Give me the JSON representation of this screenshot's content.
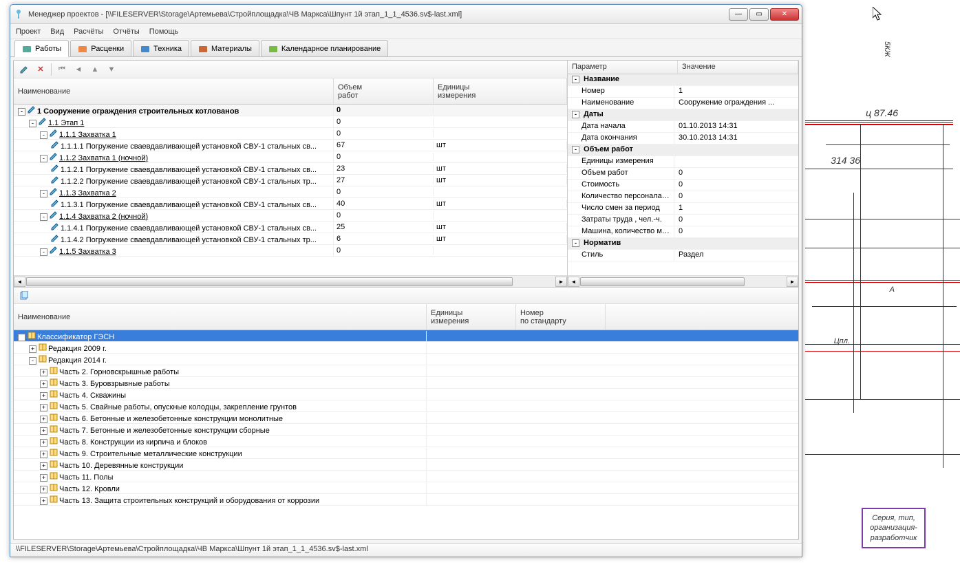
{
  "window_title": "Менеджер проектов - [\\\\FILESERVER\\Storage\\Артемьева\\Стройплощадка\\ЧВ Маркса\\Шпунт 1й этап_1_1_4536.sv$-last.xml]",
  "statusbar": "\\\\FILESERVER\\Storage\\Артемьева\\Стройплощадка\\ЧВ Маркса\\Шпунт 1й этап_1_1_4536.sv$-last.xml",
  "menu": [
    "Проект",
    "Вид",
    "Расчёты",
    "Отчёты",
    "Помощь"
  ],
  "tabs": [
    {
      "label": "Работы",
      "active": true
    },
    {
      "label": "Расценки"
    },
    {
      "label": "Техника"
    },
    {
      "label": "Материалы"
    },
    {
      "label": "Календарное планирование"
    }
  ],
  "works_grid": {
    "headers": [
      "Наименование",
      "Объем\nработ",
      "Единицы\nизмерения"
    ],
    "rows": [
      {
        "indent": 0,
        "expand": "-",
        "bold": true,
        "name": "1 Сооружение ограждения строительных котлованов",
        "vol": "0",
        "unit": ""
      },
      {
        "indent": 1,
        "expand": "-",
        "link": true,
        "name": "1.1 Этап 1",
        "vol": "0",
        "unit": ""
      },
      {
        "indent": 2,
        "expand": "-",
        "link": true,
        "name": "1.1.1 Захватка 1",
        "vol": "0",
        "unit": ""
      },
      {
        "indent": 3,
        "name": "1.1.1.1 Погружение сваевдавливающей установкой СВУ-1 стальных св...",
        "vol": "67",
        "unit": "шт"
      },
      {
        "indent": 2,
        "expand": "-",
        "link": true,
        "name": "1.1.2 Захватка 1 (ночной)",
        "vol": "0",
        "unit": ""
      },
      {
        "indent": 3,
        "name": "1.1.2.1 Погружение сваевдавливающей установкой СВУ-1 стальных св...",
        "vol": "23",
        "unit": "шт"
      },
      {
        "indent": 3,
        "name": "1.1.2.2 Погружение сваевдавливающей установкой СВУ-1 стальных тр...",
        "vol": "27",
        "unit": "шт"
      },
      {
        "indent": 2,
        "expand": "-",
        "link": true,
        "name": "1.1.3 Захватка 2",
        "vol": "0",
        "unit": ""
      },
      {
        "indent": 3,
        "name": "1.1.3.1 Погружение сваевдавливающей установкой СВУ-1 стальных св...",
        "vol": "40",
        "unit": "шт"
      },
      {
        "indent": 2,
        "expand": "-",
        "link": true,
        "name": "1.1.4 Захватка 2 (ночной)",
        "vol": "0",
        "unit": ""
      },
      {
        "indent": 3,
        "name": "1.1.4.1 Погружение сваевдавливающей установкой СВУ-1 стальных св...",
        "vol": "25",
        "unit": "шт"
      },
      {
        "indent": 3,
        "name": "1.1.4.2 Погружение сваевдавливающей установкой СВУ-1 стальных тр...",
        "vol": "6",
        "unit": "шт"
      },
      {
        "indent": 2,
        "expand": "-",
        "link": true,
        "name": "1.1.5 Захватка 3",
        "vol": "0",
        "unit": ""
      }
    ]
  },
  "props": {
    "headers": [
      "Параметр",
      "Значение"
    ],
    "groups": [
      {
        "title": "Название",
        "rows": [
          [
            "Номер",
            "1"
          ],
          [
            "Наименование",
            "Сооружение ограждения ..."
          ]
        ]
      },
      {
        "title": "Даты",
        "rows": [
          [
            "Дата начала",
            "01.10.2013 14:31"
          ],
          [
            "Дата окончания",
            "30.10.2013 14:31"
          ]
        ]
      },
      {
        "title": "Объем работ",
        "rows": [
          [
            "Единицы измерения",
            ""
          ],
          [
            "Объем работ",
            "0"
          ],
          [
            "Стоимость",
            "0"
          ],
          [
            "Количество персонала в с...",
            "0"
          ],
          [
            "Число смен за период",
            "1"
          ],
          [
            "Затраты труда , чел.-ч.",
            "0"
          ],
          [
            "Машина, количество маш...",
            "0"
          ]
        ]
      },
      {
        "title": "Норматив",
        "rows": [
          [
            "Стиль",
            "Раздел"
          ]
        ]
      }
    ]
  },
  "classifier": {
    "headers": [
      "Наименование",
      "Единицы\nизмерения",
      "Номер\nпо стандарту"
    ],
    "rows": [
      {
        "indent": 0,
        "expand": "-",
        "selected": true,
        "name": "Классификатор ГЭСН"
      },
      {
        "indent": 1,
        "expand": "+",
        "name": "Редакция 2009 г."
      },
      {
        "indent": 1,
        "expand": "-",
        "name": "Редакция 2014 г."
      },
      {
        "indent": 2,
        "expand": "+",
        "name": "Часть 2. Горновскрышные работы"
      },
      {
        "indent": 2,
        "expand": "+",
        "name": "Часть 3. Буровзрывные работы"
      },
      {
        "indent": 2,
        "expand": "+",
        "name": "Часть 4. Скважины"
      },
      {
        "indent": 2,
        "expand": "+",
        "name": "Часть 5. Свайные работы, опускные колодцы, закрепление грунтов"
      },
      {
        "indent": 2,
        "expand": "+",
        "name": "Часть 6. Бетонные и железобетонные конструкции монолитные"
      },
      {
        "indent": 2,
        "expand": "+",
        "name": "Часть 7. Бетонные и железобетонные конструкции сборные"
      },
      {
        "indent": 2,
        "expand": "+",
        "name": "Часть 8. Конструкции из кирпича и блоков"
      },
      {
        "indent": 2,
        "expand": "+",
        "name": "Часть 9. Строительные металлические конструкции"
      },
      {
        "indent": 2,
        "expand": "+",
        "name": "Часть 10. Деревянные конструкции"
      },
      {
        "indent": 2,
        "expand": "+",
        "name": "Часть 11. Полы"
      },
      {
        "indent": 2,
        "expand": "+",
        "name": "Часть 12. Кровли"
      },
      {
        "indent": 2,
        "expand": "+",
        "name": "Часть 13. Защита строительных конструкций и оборудования от коррозии"
      }
    ]
  },
  "drawing": {
    "labels": {
      "l1": "5КЖ",
      "l2": "ц 87.46",
      "l3": "314 36",
      "l4": "А",
      "l5": "Цпл."
    },
    "box": {
      "line1": "Серия, тип,",
      "line2": "организация-",
      "line3": "разработчик"
    }
  }
}
